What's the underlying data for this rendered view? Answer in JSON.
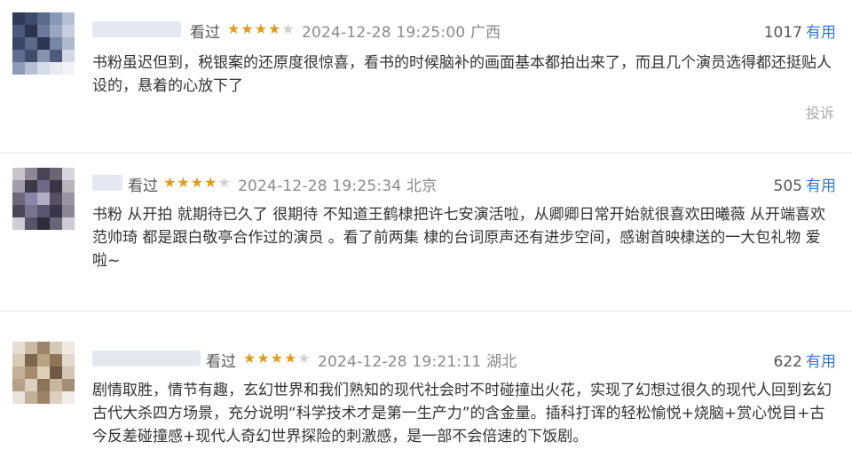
{
  "reviews": [
    {
      "status": "看过",
      "rating": 4,
      "time": "2024-12-28 19:25:00",
      "location": "广西",
      "votes": "1017",
      "useful_label": "有用",
      "text": "书粉虽迟但到，税银案的还原度很惊喜，看书的时候脑补的画面基本都拍出来了，而且几个演员选得都还挺贴人设的，悬着的心放下了",
      "report_label": "投诉"
    },
    {
      "status": "看过",
      "rating": 4,
      "time": "2024-12-28 19:25:34",
      "location": "北京",
      "votes": "505",
      "useful_label": "有用",
      "text": "书粉 从开拍 就期待已久了 很期待 不知道王鹤棣把许七安演活啦，从卿卿日常开始就很喜欢田曦薇 从开端喜欢范帅琦 都是跟白敬亭合作过的演员 。看了前两集 棣的台词原声还有进步空间，感谢首映棣送的一大包礼物 爱啦~"
    },
    {
      "status": "看过",
      "rating": 4,
      "time": "2024-12-28 19:21:11",
      "location": "湖北",
      "votes": "622",
      "useful_label": "有用",
      "text": "剧情取胜，情节有趣，玄幻世界和我们熟知的现代社会时不时碰撞出火花，实现了幻想过很久的现代人回到玄幻古代大杀四方场景，充分说明“科学技术才是第一生产力”的含金量。插科打诨的轻松愉悦+烧脑+赏心悦目+古今反差碰撞感+现代人奇幻世界探险的刺激感，是一部不会倍速的下饭剧。"
    }
  ],
  "star_icon": "★",
  "colors": {
    "star": "#e09a1e",
    "useful": "#3a77c8",
    "meta": "#8a8a8a"
  }
}
